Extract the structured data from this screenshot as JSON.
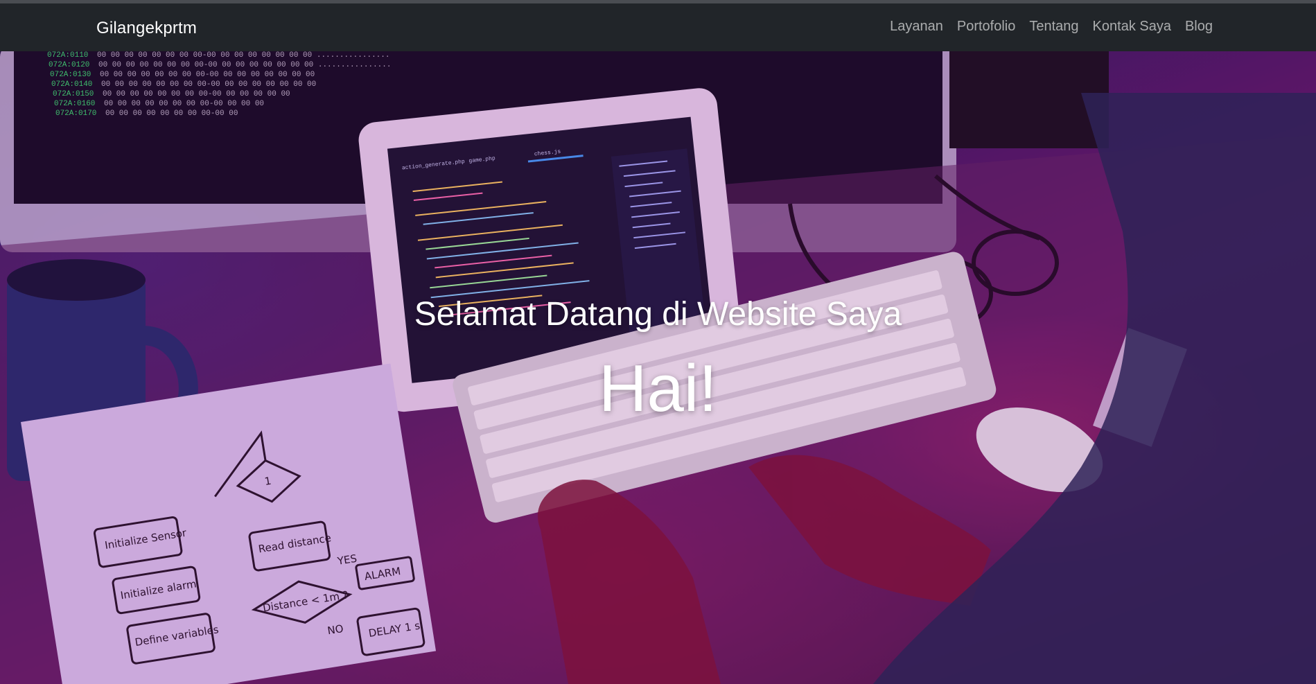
{
  "navbar": {
    "brand": "Gilangekprtm",
    "links": [
      {
        "label": "Layanan"
      },
      {
        "label": "Portofolio"
      },
      {
        "label": "Tentang"
      },
      {
        "label": "Kontak Saya"
      },
      {
        "label": "Blog"
      }
    ]
  },
  "hero": {
    "subtitle": "Selamat Datang di Website Saya",
    "headline": "Hai!",
    "background": {
      "description_icon": "desk-coding-photo",
      "tablet_tabs": [
        "action_generate.php",
        "game.php",
        "chess.js"
      ],
      "flowchart_labels": [
        "Initialize Sensor",
        "Initialize alarm",
        "Define variables",
        "Read distance",
        "Distance < 1m ?",
        "YES",
        "ALARM",
        "NO",
        "DELAY 1 s",
        "1"
      ],
      "monitor_hex_lines": [
        "072A:0110",
        "072A:0120",
        "072A:0130",
        "072A:0140",
        "072A:0150",
        "072A:0160",
        "072A:0170"
      ]
    }
  },
  "colors": {
    "navbar_bg": "#212529",
    "nav_link": "rgba(255,255,255,0.62)",
    "brand": "#ffffff",
    "hero_text": "#ffffff"
  }
}
